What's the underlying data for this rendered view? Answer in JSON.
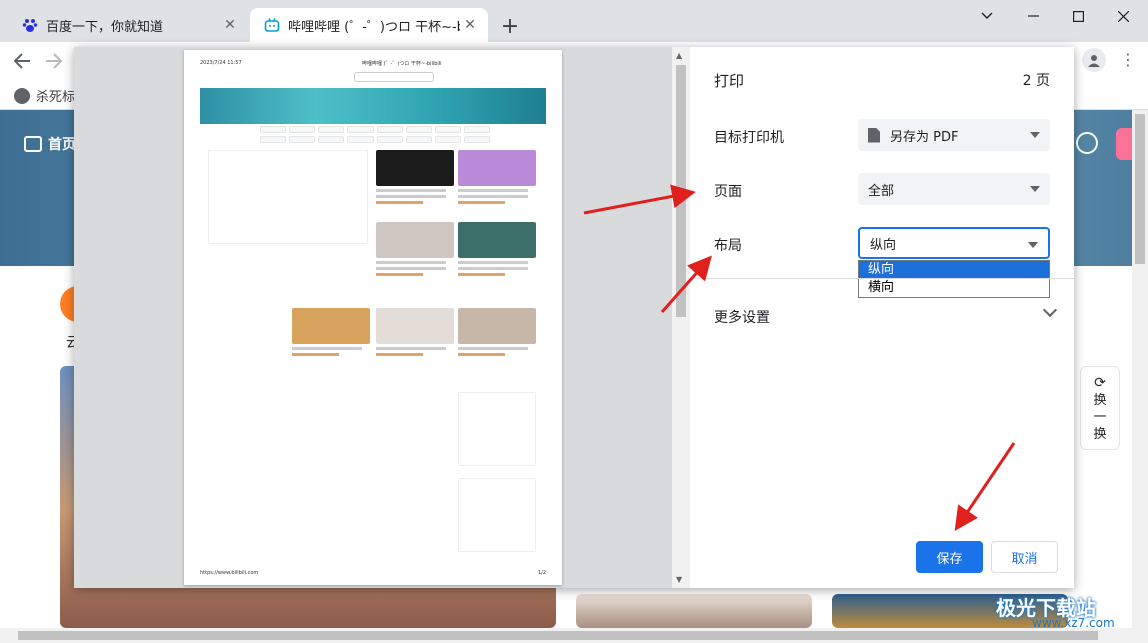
{
  "browser": {
    "tabs": [
      {
        "title": "百度一下，你就知道",
        "active": false
      },
      {
        "title": "哔哩哔哩 (゜-゜)つロ 干杯~-bilibili",
        "active": true
      }
    ],
    "bookmark_label": "杀死标签",
    "new_tab_symbol": "+"
  },
  "background_page": {
    "home_label": "首页",
    "yun_label": "云",
    "swap_label": [
      "换",
      "一",
      "换"
    ],
    "watermark": "极光下载站",
    "watermark_url": "www.xz7.com"
  },
  "print_preview": {
    "header_date": "2023/7/24 11:57",
    "header_title": "哔哩哔哩 (゜-゜)つロ 干杯~-bilibili",
    "footer_url": "https://www.bilibili.com",
    "footer_page": "1/2"
  },
  "print_settings": {
    "title": "打印",
    "page_count": "2 页",
    "destination_label": "目标打印机",
    "destination_value": "另存为 PDF",
    "pages_label": "页面",
    "pages_value": "全部",
    "layout_label": "布局",
    "layout_value": "纵向",
    "layout_options": [
      "纵向",
      "横向"
    ],
    "more_settings_label": "更多设置",
    "save_label": "保存",
    "cancel_label": "取消"
  },
  "colors": {
    "accent": "#1a73e8",
    "annotation_arrow": "#e0201c"
  }
}
